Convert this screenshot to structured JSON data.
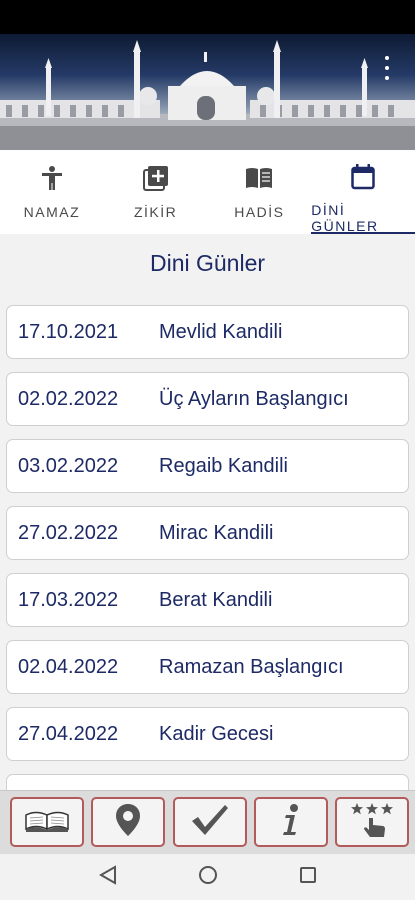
{
  "tabs": [
    {
      "label": "NAMAZ",
      "icon": "person-icon"
    },
    {
      "label": "ZİKİR",
      "icon": "add-box-icon"
    },
    {
      "label": "HADİS",
      "icon": "book-icon"
    },
    {
      "label": "DİNİ GÜNLER",
      "icon": "calendar-icon",
      "active": true
    }
  ],
  "page": {
    "title": "Dini Günler"
  },
  "days": [
    {
      "date": "17.10.2021",
      "name": "Mevlid Kandili"
    },
    {
      "date": "02.02.2022",
      "name": "Üç Ayların Başlangıcı"
    },
    {
      "date": "03.02.2022",
      "name": "Regaib Kandili"
    },
    {
      "date": "27.02.2022",
      "name": "Mirac Kandili"
    },
    {
      "date": "17.03.2022",
      "name": "Berat Kandili"
    },
    {
      "date": "02.04.2022",
      "name": "Ramazan Başlangıcı"
    },
    {
      "date": "27.04.2022",
      "name": "Kadir Gecesi"
    }
  ],
  "bottom_bar": [
    "open-book-icon",
    "location-pin-icon",
    "checkmark-icon",
    "info-icon",
    "rate-stars-icon"
  ],
  "colors": {
    "primary": "#1d2a66",
    "button_border": "#b35a5a"
  }
}
